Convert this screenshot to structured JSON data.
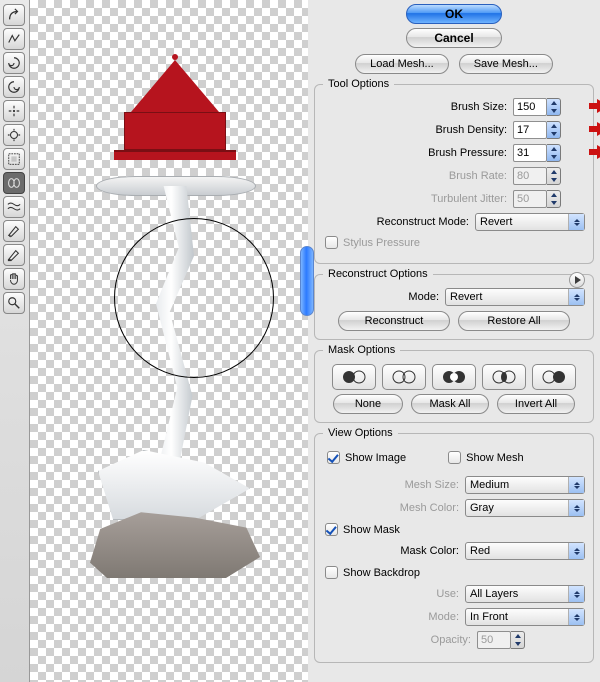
{
  "buttons": {
    "ok": "OK",
    "cancel": "Cancel",
    "load": "Load Mesh...",
    "save": "Save Mesh...",
    "reconstruct": "Reconstruct",
    "restore": "Restore All",
    "none": "None",
    "maskall": "Mask All",
    "invert": "Invert All"
  },
  "group": {
    "tool": "Tool Options",
    "reconstruct": "Reconstruct Options",
    "mask": "Mask Options",
    "view": "View Options"
  },
  "tool": {
    "size_label": "Brush Size:",
    "size": "150",
    "density_label": "Brush Density:",
    "density": "17",
    "pressure_label": "Brush Pressure:",
    "pressure": "31",
    "rate_label": "Brush Rate:",
    "rate": "80",
    "jitter_label": "Turbulent Jitter:",
    "jitter": "50",
    "reconmode_label": "Reconstruct Mode:",
    "reconmode": "Revert",
    "stylus": "Stylus Pressure"
  },
  "recon": {
    "mode_label": "Mode:",
    "mode": "Revert"
  },
  "view": {
    "showimage": "Show Image",
    "showmesh": "Show Mesh",
    "meshsize_label": "Mesh Size:",
    "meshsize": "Medium",
    "meshcolor_label": "Mesh Color:",
    "meshcolor": "Gray",
    "showmask": "Show Mask",
    "maskcolor_label": "Mask Color:",
    "maskcolor": "Red",
    "backdrop": "Show Backdrop",
    "use_label": "Use:",
    "use": "All Layers",
    "bmode_label": "Mode:",
    "bmode": "In Front",
    "opacity_label": "Opacity:",
    "opacity": "50"
  },
  "tools": [
    "forward-warp",
    "reconstruct",
    "twirl-cw",
    "twirl-ccw",
    "pucker",
    "bloat",
    "push-left",
    "mirror",
    "turbulence",
    "freeze-mask",
    "thaw-mask",
    "hand",
    "zoom"
  ],
  "selected_tool_index": 7
}
